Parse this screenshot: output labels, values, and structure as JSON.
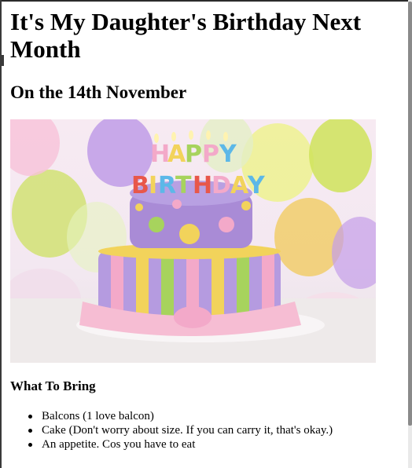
{
  "page": {
    "title": "It's My Daughter's Birthday Next Month",
    "subtitle": "On the 14th November",
    "section_heading": "What To Bring"
  },
  "hero_image": {
    "alt": "birthday cake photo",
    "cake_lettering": "HAPPY BIRTHDAY"
  },
  "bring_list": [
    "Balcons (1 love balcon)",
    "Cake (Don't worry about size. If you can carry it, that's okay.)",
    "An appetite. Cos you have to eat"
  ],
  "colors": {
    "background": "#ffffff",
    "text": "#000000",
    "cake_purple": "#a98bd6",
    "cake_pink": "#f3a9c9",
    "cake_yellow": "#f2d35b",
    "cake_green": "#a7d35d"
  }
}
